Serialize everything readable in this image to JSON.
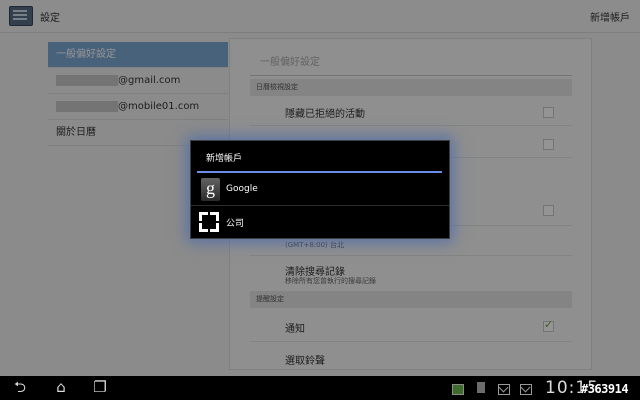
{
  "header": {
    "title": "設定",
    "add_account": "新增帳戶"
  },
  "sidebar": {
    "items": [
      {
        "label": "一般偏好設定",
        "selected": true
      },
      {
        "label": "@gmail.com"
      },
      {
        "label": "@mobile01.com"
      },
      {
        "label": "關於日曆"
      }
    ]
  },
  "panel": {
    "title": "一般偏好設定",
    "sections": [
      {
        "header": "日曆檢視設定"
      },
      {
        "header": "提醒設定"
      }
    ],
    "rows": {
      "hide_declined": {
        "label": "隱藏已拒絕的活動",
        "checked": false
      },
      "clear_history": {
        "label": "清除搜尋記錄",
        "sub": "移除所有您曾執行的搜尋記錄"
      },
      "timezone_sub": "(GMT+8:00) 台北",
      "notify": {
        "label": "通知",
        "checked": true
      },
      "ringtone": {
        "label": "選取鈴聲"
      }
    }
  },
  "dialog": {
    "title": "新增帳戶",
    "options": [
      {
        "label": "Google",
        "icon": "google-icon"
      },
      {
        "label": "公司",
        "icon": "corporate-icon"
      }
    ],
    "accent_color": "#6a8ee6"
  },
  "navbar": {
    "buttons": [
      "back-icon",
      "home-icon",
      "recent-apps-icon"
    ],
    "clock": "10:15",
    "watermark": "#363914"
  }
}
